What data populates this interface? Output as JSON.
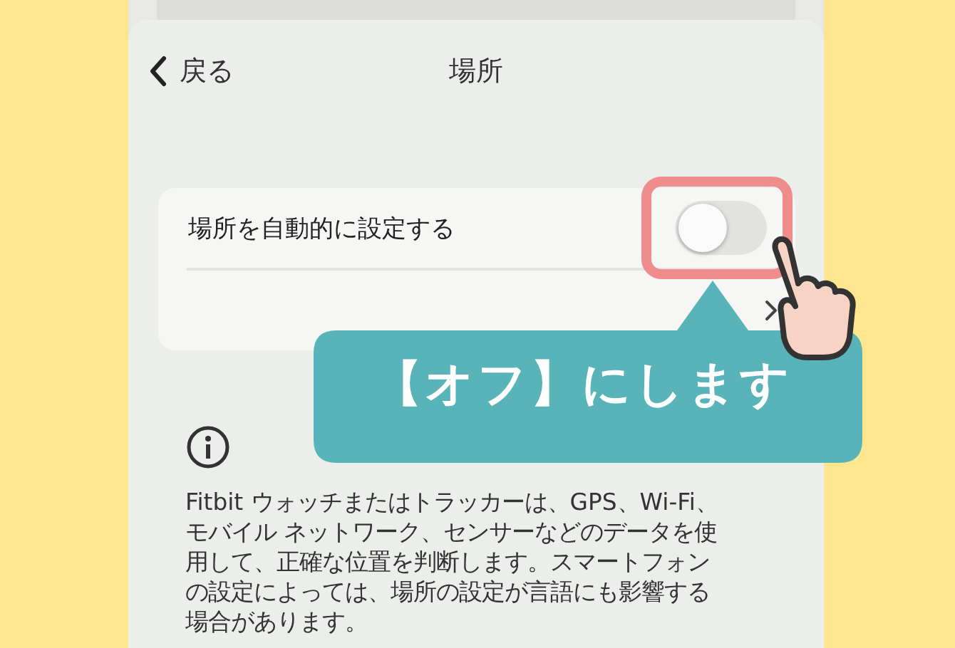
{
  "header": {
    "back_label": "戻る",
    "title": "場所"
  },
  "settings": [
    {
      "kind": "toggle",
      "label": "場所を自動的に設定する",
      "on": false,
      "highlighted": true
    },
    {
      "kind": "link"
    }
  ],
  "annotation": {
    "callout": "【オフ】にします"
  },
  "info": {
    "text": "Fitbit ウォッチまたはトラッカーは、GPS、Wi-Fi、モバイル ネットワーク、センサーなどのデータを使用して、正確な位置を判断します。スマートフォンの設定によっては、場所の設定が言語にも影響する場合があります。"
  }
}
